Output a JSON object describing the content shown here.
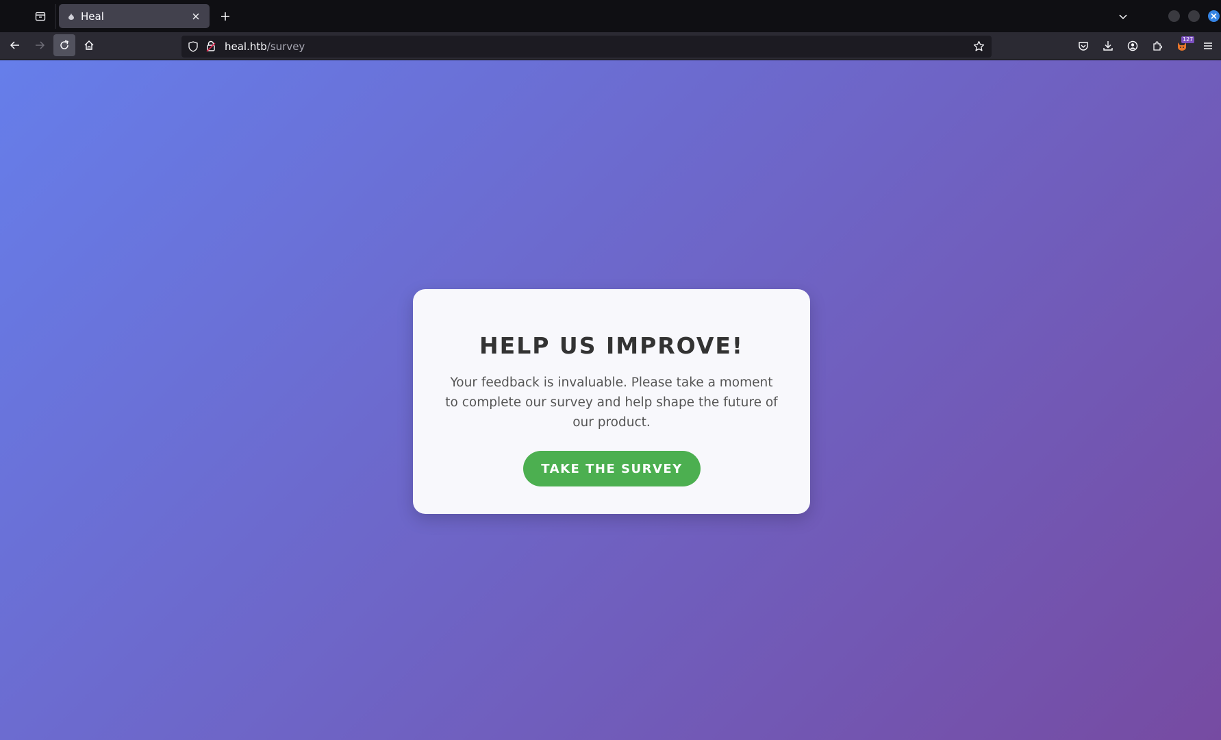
{
  "browser": {
    "tab": {
      "title": "Heal"
    },
    "url": {
      "host": "heal.htb",
      "path": "/survey"
    },
    "toolbar": {
      "extension_badge": "127"
    }
  },
  "page": {
    "background_gradient": [
      "#667eea",
      "#764ba2"
    ],
    "card": {
      "title": "HELP US IMPROVE!",
      "body": "Your feedback is invaluable. Please take a moment to complete our survey and help shape the future of our product.",
      "cta_label": "TAKE THE SURVEY",
      "cta_color": "#4caf50"
    }
  }
}
